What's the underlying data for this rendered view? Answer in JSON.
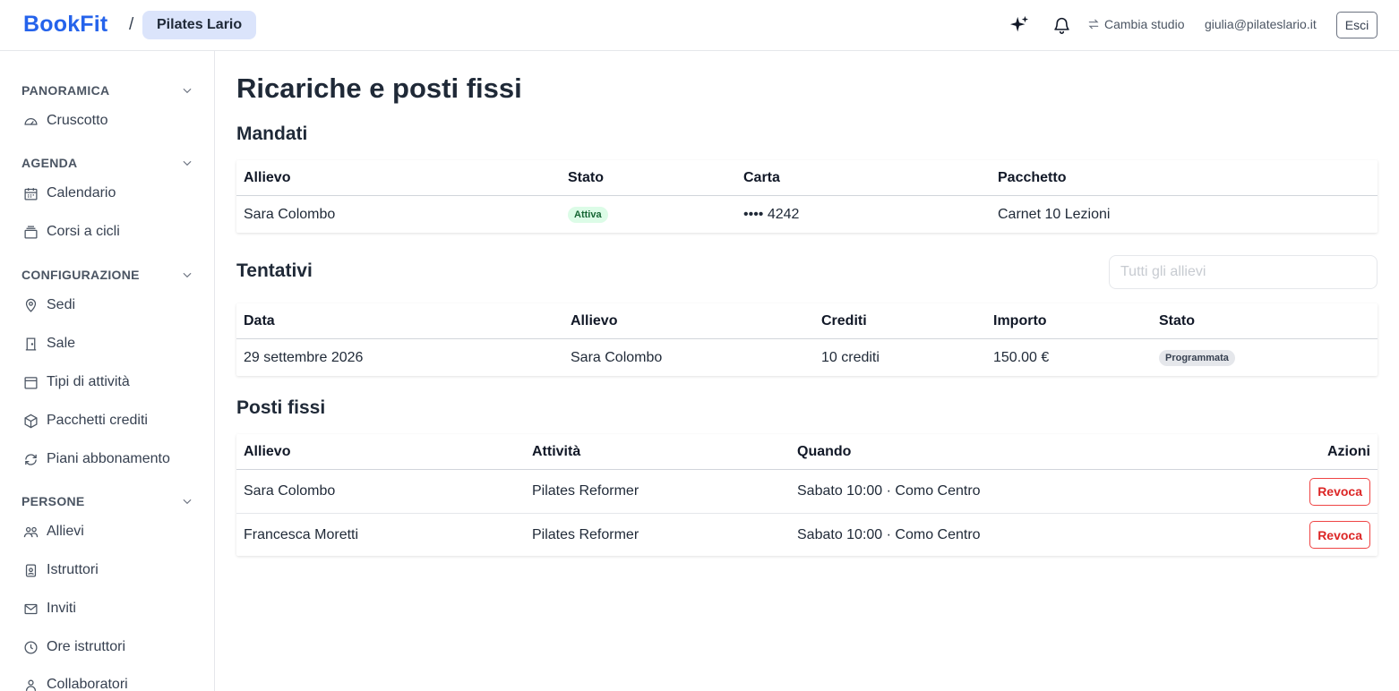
{
  "header": {
    "brand": "BookFit",
    "separator": "/",
    "studio": "Pilates Lario",
    "switch_label": "Cambia studio",
    "user_email": "giulia@pilateslario.it",
    "logout_label": "Esci",
    "icons": [
      "sparkles-icon",
      "bell-icon",
      "switch-arrows-icon"
    ]
  },
  "sidebar": {
    "sections": [
      {
        "title": "PANORAMICA",
        "items": [
          {
            "label": "Cruscotto",
            "icon": "dashboard-icon"
          }
        ]
      },
      {
        "title": "AGENDA",
        "items": [
          {
            "label": "Calendario",
            "icon": "calendar-icon"
          },
          {
            "label": "Corsi a cicli",
            "icon": "courses-icon"
          }
        ]
      },
      {
        "title": "CONFIGURAZIONE",
        "items": [
          {
            "label": "Sedi",
            "icon": "map-pin-icon"
          },
          {
            "label": "Sale",
            "icon": "door-icon"
          },
          {
            "label": "Tipi di attività",
            "icon": "activity-type-icon"
          },
          {
            "label": "Pacchetti crediti",
            "icon": "package-icon"
          },
          {
            "label": "Piani abbonamento",
            "icon": "refresh-icon"
          }
        ]
      },
      {
        "title": "PERSONE",
        "items": [
          {
            "label": "Allievi",
            "icon": "users-icon"
          },
          {
            "label": "Istruttori",
            "icon": "badge-icon"
          },
          {
            "label": "Inviti",
            "icon": "mail-icon"
          },
          {
            "label": "Ore istruttori",
            "icon": "clock-icon"
          },
          {
            "label": "Collaboratori",
            "icon": "user-icon"
          }
        ]
      }
    ]
  },
  "main": {
    "title": "Ricariche e posti fissi",
    "mandates": {
      "title": "Mandati",
      "columns": [
        "Allievo",
        "Stato",
        "Carta",
        "Pacchetto"
      ],
      "rows": [
        {
          "student": "Sara Colombo",
          "status": "Attiva",
          "card": "•••• 4242",
          "package": "Carnet 10 Lezioni"
        }
      ]
    },
    "attempts": {
      "title": "Tentativi",
      "filter_placeholder": "Tutti gli allievi",
      "columns": [
        "Data",
        "Allievo",
        "Crediti",
        "Importo",
        "Stato"
      ],
      "rows": [
        {
          "date": "29 settembre 2026",
          "student": "Sara Colombo",
          "credits": "10 crediti",
          "amount": "150.00 €",
          "status": "Programmata"
        }
      ]
    },
    "fixed_spots": {
      "title": "Posti fissi",
      "columns": [
        "Allievo",
        "Attività",
        "Quando",
        "Azioni"
      ],
      "action_label": "Revoca",
      "rows": [
        {
          "student": "Sara Colombo",
          "activity": "Pilates Reformer",
          "when": "Sabato 10:00 · Como Centro"
        },
        {
          "student": "Francesca Moretti",
          "activity": "Pilates Reformer",
          "when": "Sabato 10:00 · Como Centro"
        }
      ]
    }
  },
  "colors": {
    "brand": "#2563eb",
    "pill_bg": "#dbe4fb",
    "active_badge": "#dcfce7",
    "danger": "#dc2626"
  }
}
